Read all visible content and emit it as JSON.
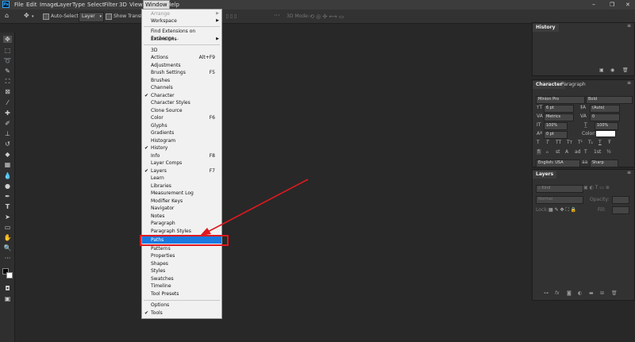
{
  "menubar": {
    "logo": "Ps",
    "items": [
      "File",
      "Edit",
      "Image",
      "Layer",
      "Type",
      "Select",
      "Filter",
      "3D",
      "View",
      "Window",
      "Help"
    ]
  },
  "options": {
    "autoselect_label": "Auto-Select:",
    "layer_value": "Layer",
    "show_transform_label": "Show Transform C",
    "mode_3d_label": "3D Mode:"
  },
  "window_menu": {
    "items": [
      {
        "label": "Arrange",
        "submenu": true,
        "disabled": true
      },
      {
        "label": "Workspace",
        "submenu": true
      },
      {
        "label": "Find Extensions on Exchange..."
      },
      {
        "label": "Extensions",
        "submenu": true
      },
      {
        "label": "3D"
      },
      {
        "label": "Actions",
        "shortcut": "Alt+F9"
      },
      {
        "label": "Adjustments"
      },
      {
        "label": "Brush Settings",
        "shortcut": "F5"
      },
      {
        "label": "Brushes"
      },
      {
        "label": "Channels"
      },
      {
        "label": "Character",
        "checked": true
      },
      {
        "label": "Character Styles"
      },
      {
        "label": "Clone Source"
      },
      {
        "label": "Color",
        "shortcut": "F6"
      },
      {
        "label": "Glyphs"
      },
      {
        "label": "Gradients"
      },
      {
        "label": "Histogram"
      },
      {
        "label": "History",
        "checked": true
      },
      {
        "label": "Info",
        "shortcut": "F8"
      },
      {
        "label": "Layer Comps"
      },
      {
        "label": "Layers",
        "checked": true,
        "shortcut": "F7"
      },
      {
        "label": "Learn"
      },
      {
        "label": "Libraries"
      },
      {
        "label": "Measurement Log"
      },
      {
        "label": "Modifier Keys"
      },
      {
        "label": "Navigator"
      },
      {
        "label": "Notes"
      },
      {
        "label": "Paragraph"
      },
      {
        "label": "Paragraph Styles"
      },
      {
        "label": "Paths",
        "highlighted": true
      },
      {
        "label": "Patterns"
      },
      {
        "label": "Properties"
      },
      {
        "label": "Shapes"
      },
      {
        "label": "Styles"
      },
      {
        "label": "Swatches"
      },
      {
        "label": "Timeline"
      },
      {
        "label": "Tool Presets"
      },
      {
        "label": "Options"
      },
      {
        "label": "Tools",
        "checked": true
      }
    ]
  },
  "history_panel": {
    "title": "History"
  },
  "character_panel": {
    "tab_character": "Character",
    "tab_paragraph": "Paragraph",
    "font_family": "Minion Pro",
    "font_style": "Bold",
    "font_size": "6 pt",
    "leading": "(Auto)",
    "kerning": "Metrics",
    "tracking": "0",
    "vertical_scale": "100%",
    "horizontal_scale": "100%",
    "baseline_shift": "0 pt",
    "color_label": "Color:",
    "language": "English: USA",
    "antialias": "Sharp",
    "style_buttons": [
      "T",
      "T",
      "TT",
      "Tт",
      "T¹",
      "T₁",
      "T",
      "Ŧ"
    ],
    "ot_buttons": [
      "fi",
      "ℴ",
      "st",
      "A",
      "ad",
      "T",
      "1st",
      "½"
    ]
  },
  "layers_panel": {
    "title": "Layers",
    "kind": "Kind",
    "blend_mode": "Normal",
    "opacity_label": "Opacity:",
    "lock_label": "Lock:",
    "fill_label": "Fill:"
  },
  "colors": {
    "highlight": "#1a7ae0",
    "annotation": "#e0191f",
    "app_bg": "#282828",
    "logo": "#31a8ff"
  }
}
